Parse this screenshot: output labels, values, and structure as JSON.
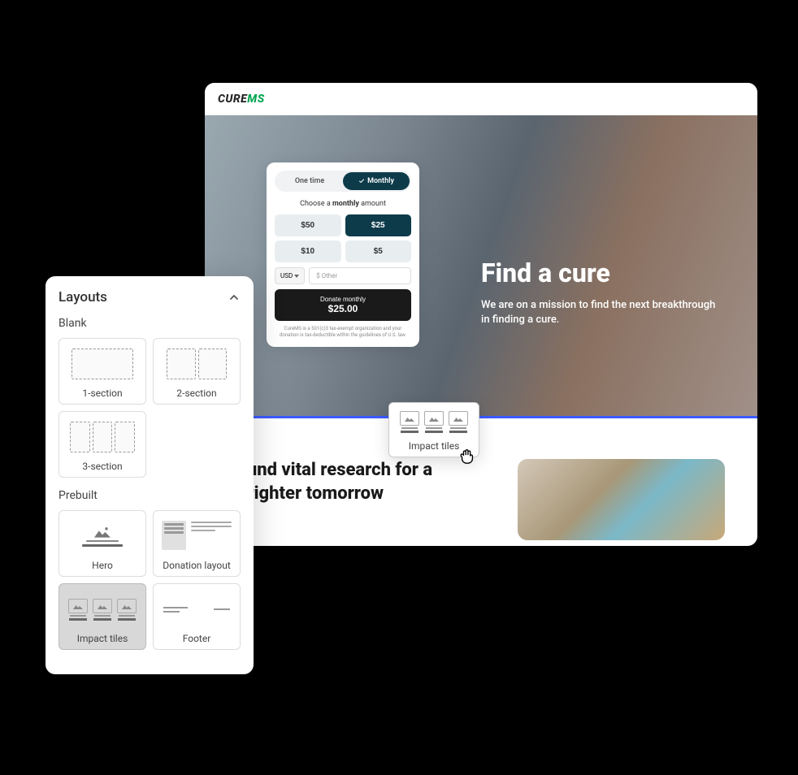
{
  "preview": {
    "logo_cure": "CURE",
    "logo_ms": "MS",
    "hero_title": "Find a cure",
    "hero_subtitle": "We are on a mission to find the next breakthrough in finding a cure.",
    "content_title": "Fund vital research for a brighter tomorrow"
  },
  "donation": {
    "toggle_onetime": "One time",
    "toggle_monthly": "Monthly",
    "choose_prefix": "Choose a ",
    "choose_bold": "monthly",
    "choose_suffix": " amount",
    "amounts": [
      "$50",
      "$25",
      "$10",
      "$5"
    ],
    "selected_index": 1,
    "currency": "USD",
    "other_placeholder": "$ Other",
    "donate_label": "Donate monthly",
    "donate_amount": "$25.00",
    "tax_note": "CureMS is a 501(c)3 tax-exempt organization and your donation is tax-deductible within the guidelines of U.S. law."
  },
  "layouts_panel": {
    "title": "Layouts",
    "section_blank": "Blank",
    "section_prebuilt": "Prebuilt",
    "blank_items": [
      "1-section",
      "2-section",
      "3-section"
    ],
    "prebuilt_items": [
      "Hero",
      "Donation layout",
      "Impact tiles",
      "Footer"
    ]
  },
  "dragged": {
    "label": "Impact tiles"
  }
}
